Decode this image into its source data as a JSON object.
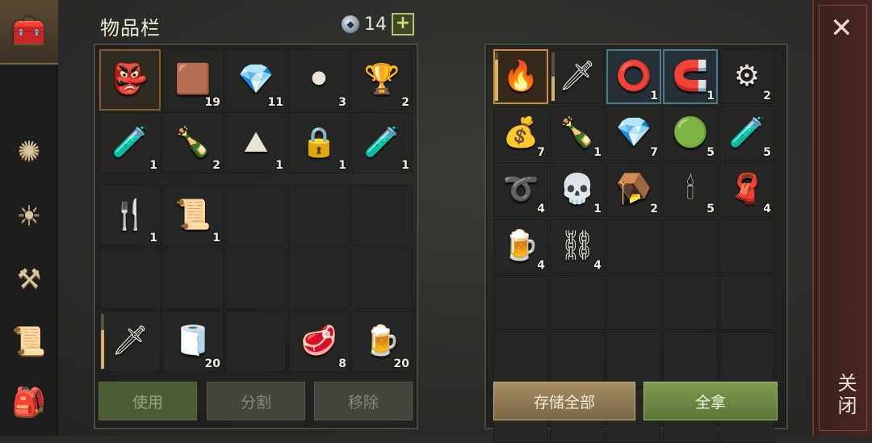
{
  "header": {
    "title": "物品栏",
    "currency_amount": "14",
    "add_label": "+"
  },
  "sidebar": {
    "items": [
      "chest-icon",
      "compass-icon",
      "sun-book-icon",
      "crafting-hammer-icon",
      "quest-scroll-icon",
      "character-backpack-icon"
    ],
    "glyphs": [
      "🧰",
      "✺",
      "☀",
      "⚒",
      "📜",
      "🎒"
    ]
  },
  "inventory": {
    "top": [
      {
        "name": "witch-mask",
        "glyph": "👺",
        "count": "",
        "state": "selected"
      },
      {
        "name": "leather-hide",
        "glyph": "🟫",
        "count": "19"
      },
      {
        "name": "magic-crystal",
        "glyph": "💎",
        "count": "11"
      },
      {
        "name": "coal",
        "glyph": "⚫",
        "count": "3"
      },
      {
        "name": "golden-goblet",
        "glyph": "🏆",
        "count": "2"
      },
      {
        "name": "potion-flask",
        "glyph": "🧪",
        "count": "1"
      },
      {
        "name": "leather-bottle",
        "glyph": "🍾",
        "count": "2"
      },
      {
        "name": "sulfur-pile",
        "glyph": "⛰",
        "count": "1"
      },
      {
        "name": "padlock",
        "glyph": "🔒",
        "count": "1"
      },
      {
        "name": "potion-flask",
        "glyph": "🧪",
        "count": "1"
      }
    ],
    "bottom": [
      {
        "name": "fork",
        "glyph": "🍴",
        "count": "1"
      },
      {
        "name": "ritual-scroll",
        "glyph": "📜",
        "count": "1"
      },
      {
        "name": "empty",
        "glyph": "",
        "count": ""
      },
      {
        "name": "empty",
        "glyph": "",
        "count": ""
      },
      {
        "name": "empty",
        "glyph": "",
        "count": ""
      },
      {
        "name": "empty",
        "glyph": "",
        "count": ""
      },
      {
        "name": "empty",
        "glyph": "",
        "count": ""
      },
      {
        "name": "empty",
        "glyph": "",
        "count": ""
      },
      {
        "name": "empty",
        "glyph": "",
        "count": ""
      },
      {
        "name": "empty",
        "glyph": "",
        "count": ""
      },
      {
        "name": "sword",
        "glyph": "🗡",
        "count": "",
        "durability": 0.7
      },
      {
        "name": "cloth-roll",
        "glyph": "🧻",
        "count": "20"
      },
      {
        "name": "empty",
        "glyph": "",
        "count": ""
      },
      {
        "name": "raw-steak",
        "glyph": "🥩",
        "count": "8"
      },
      {
        "name": "wooden-mug",
        "glyph": "🍺",
        "count": "20"
      }
    ]
  },
  "storage": {
    "items": [
      {
        "name": "flaming-sword",
        "glyph": "🔥",
        "count": "",
        "state": "selected2",
        "durability": 0.85
      },
      {
        "name": "scimitar",
        "glyph": "🗡",
        "count": "",
        "durability": 0.5
      },
      {
        "name": "leather-collar",
        "glyph": "⭕",
        "count": "1",
        "state": "blue"
      },
      {
        "name": "iron-clamp",
        "glyph": "🧲",
        "count": "1",
        "state": "blue"
      },
      {
        "name": "gear-part",
        "glyph": "⚙",
        "count": "2"
      },
      {
        "name": "grain-sack",
        "glyph": "💰",
        "count": "7"
      },
      {
        "name": "leather-bottle",
        "glyph": "🍾",
        "count": "1"
      },
      {
        "name": "magic-crystal",
        "glyph": "💎",
        "count": "7"
      },
      {
        "name": "herb-ball",
        "glyph": "🟢",
        "count": "5"
      },
      {
        "name": "water-flask",
        "glyph": "🧪",
        "count": "5"
      },
      {
        "name": "wire",
        "glyph": "➰",
        "count": "4"
      },
      {
        "name": "skull",
        "glyph": "💀",
        "count": "1"
      },
      {
        "name": "bear-trap",
        "glyph": "🪤",
        "count": "2"
      },
      {
        "name": "candle",
        "glyph": "🕯",
        "count": "5"
      },
      {
        "name": "folded-cloth",
        "glyph": "🧣",
        "count": "4"
      },
      {
        "name": "wooden-mug",
        "glyph": "🍺",
        "count": "4"
      },
      {
        "name": "chain",
        "glyph": "⛓",
        "count": "4"
      },
      {
        "name": "empty",
        "glyph": "",
        "count": ""
      },
      {
        "name": "empty",
        "glyph": "",
        "count": ""
      },
      {
        "name": "empty",
        "glyph": "",
        "count": ""
      },
      {
        "name": "empty",
        "glyph": "",
        "count": ""
      },
      {
        "name": "empty",
        "glyph": "",
        "count": ""
      },
      {
        "name": "empty",
        "glyph": "",
        "count": ""
      },
      {
        "name": "empty",
        "glyph": "",
        "count": ""
      },
      {
        "name": "empty",
        "glyph": "",
        "count": ""
      },
      {
        "name": "empty",
        "glyph": "",
        "count": ""
      },
      {
        "name": "empty",
        "glyph": "",
        "count": ""
      },
      {
        "name": "empty",
        "glyph": "",
        "count": ""
      },
      {
        "name": "empty",
        "glyph": "",
        "count": ""
      },
      {
        "name": "empty",
        "glyph": "",
        "count": ""
      },
      {
        "name": "empty",
        "glyph": "",
        "count": ""
      },
      {
        "name": "empty",
        "glyph": "",
        "count": ""
      },
      {
        "name": "empty",
        "glyph": "",
        "count": ""
      },
      {
        "name": "empty",
        "glyph": "",
        "count": ""
      },
      {
        "name": "empty",
        "glyph": "",
        "count": ""
      }
    ]
  },
  "buttons": {
    "use": "使用",
    "split": "分割",
    "remove": "移除",
    "store_all": "存储全部",
    "take_all": "全拿"
  },
  "close": {
    "label": "关闭",
    "x": "✕"
  }
}
